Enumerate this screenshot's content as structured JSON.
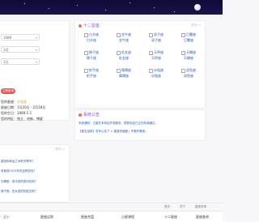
{
  "left_panel": {
    "select1": "1989",
    "select2": "1月",
    "select3": "1日",
    "button": "立即查询",
    "info": [
      {
        "label": "您的星座：",
        "value": "水瓶座",
        "accent": true
      },
      {
        "label": "星座日期：",
        "value": "1月20日 - 2月18日",
        "accent": false
      },
      {
        "label": "您的生日：",
        "value": "1989-1-1",
        "accent": false
      },
      {
        "label": "您的特征：",
        "value": "独立、创新、博爱",
        "accent": false
      }
    ]
  },
  "zodiac": {
    "title": "十二星座",
    "more": "更多>>",
    "signs": [
      {
        "l1": "白羊座",
        "l2": "白羊座"
      },
      {
        "l1": "金牛座",
        "l2": "金牛座"
      },
      {
        "l1": "双子座",
        "l2": "双子座"
      },
      {
        "l1": "巨蟹座",
        "l2": "巨蟹座"
      },
      {
        "l1": "狮子座",
        "l2": "狮子座"
      },
      {
        "l1": "处女座",
        "l2": "处女座"
      },
      {
        "l1": "天秤座",
        "l2": "天秤座"
      },
      {
        "l1": "天蝎座",
        "l2": "天蝎座"
      },
      {
        "l1": "射手座",
        "l2": "射手座"
      },
      {
        "l1": "摩羯座",
        "l2": "摩羯座"
      },
      {
        "l1": "水瓶座",
        "l2": "水瓶座"
      },
      {
        "l1": "双鱼座",
        "l2": "双鱼座"
      }
    ]
  },
  "notice": {
    "title": "系统公告",
    "items": [
      "系统通知：占星在本网站开放服务，很受欢迎已正在前端通过...",
      "【星空运势】发布公告了 > 星座的偏爱 | 专属的情感..."
    ]
  },
  "qa": {
    "more": "更多>>",
    "items": [
      "星座和命运之间有关联吗？",
      "双鱼座2025年的运势如何？",
      "天蝎座、射手座的配对如何？",
      "狮子座、处女座的相处如何？"
    ]
  },
  "footer_top": [
    "首页",
    "关于",
    "星座查询"
  ],
  "footer": [
    "占卜",
    "星座运势",
    "星座合盘",
    "占星课程",
    "十二星座",
    "星座查询"
  ]
}
